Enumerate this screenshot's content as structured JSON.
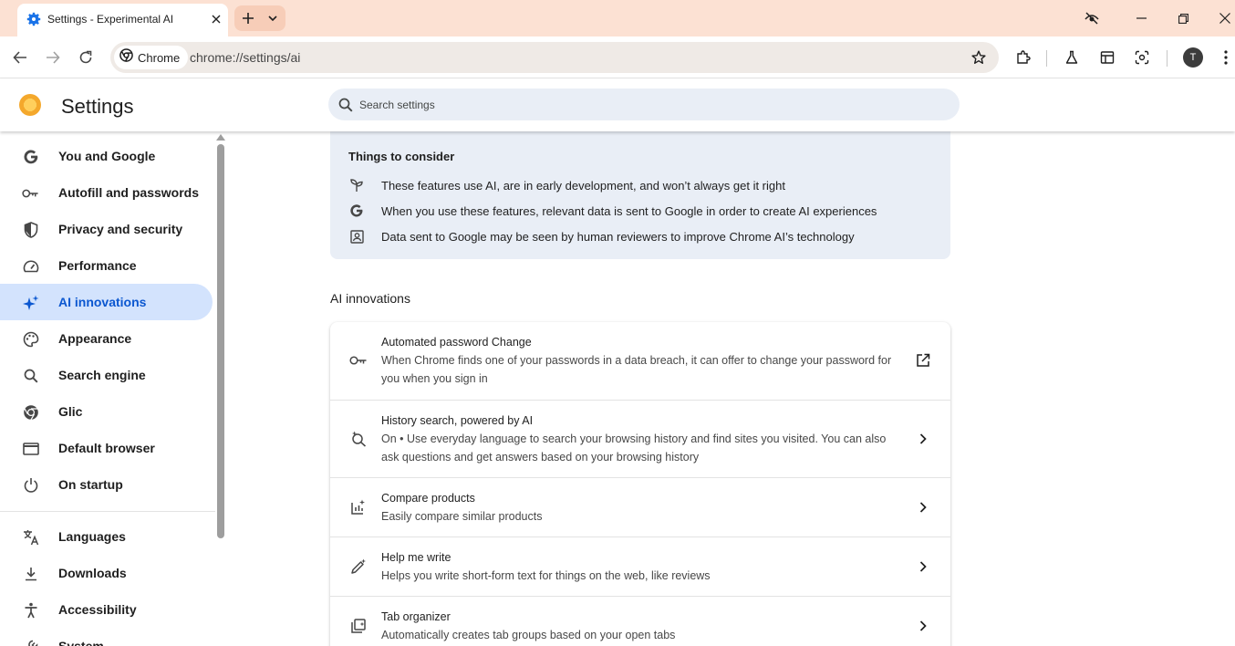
{
  "browser": {
    "tab_title": "Settings - Experimental AI",
    "chip_label": "Chrome",
    "url": "chrome://settings/ai",
    "profile_initial": "T",
    "accent_color": "#0b57d0",
    "frame_color": "#fce1d3"
  },
  "settings": {
    "title": "Settings",
    "search_placeholder": "Search settings"
  },
  "sidebar": {
    "items": [
      {
        "label": "You and Google",
        "icon": "google-g-icon"
      },
      {
        "label": "Autofill and passwords",
        "icon": "key-icon"
      },
      {
        "label": "Privacy and security",
        "icon": "shield-icon"
      },
      {
        "label": "Performance",
        "icon": "speedometer-icon"
      },
      {
        "label": "AI innovations",
        "icon": "sparkle-icon",
        "active": true
      },
      {
        "label": "Appearance",
        "icon": "palette-icon"
      },
      {
        "label": "Search engine",
        "icon": "search-icon"
      },
      {
        "label": "Glic",
        "icon": "chrome-icon"
      },
      {
        "label": "Default browser",
        "icon": "browser-window-icon"
      },
      {
        "label": "On startup",
        "icon": "power-icon"
      },
      {
        "label": "Languages",
        "icon": "translate-icon"
      },
      {
        "label": "Downloads",
        "icon": "download-icon"
      },
      {
        "label": "Accessibility",
        "icon": "accessibility-icon"
      },
      {
        "label": "System",
        "icon": "wrench-icon"
      }
    ]
  },
  "consider": {
    "heading": "Things to consider",
    "items": [
      {
        "text": "These features use AI, are in early development, and won’t always get it right",
        "icon": "sprout-icon"
      },
      {
        "text": "When you use these features, relevant data is sent to Google in order to create AI experiences",
        "icon": "google-g-icon"
      },
      {
        "text": "Data sent to Google may be seen by human reviewers to improve Chrome AI’s technology",
        "icon": "reviewer-icon"
      }
    ]
  },
  "ai_section": {
    "title": "AI innovations",
    "rows": [
      {
        "title": "Automated password Change",
        "desc": "When Chrome finds one of your passwords in a data breach, it can offer to change your password for you when you sign in",
        "icon": "key-icon",
        "action": "open-external-icon"
      },
      {
        "title": "History search, powered by AI",
        "desc": "On • Use everyday language to search your browsing history and find sites you visited. You can also ask questions and get answers based on your browsing history",
        "icon": "search-sparkle-icon",
        "action": "chevron-right-icon"
      },
      {
        "title": "Compare products",
        "desc": "Easily compare similar products",
        "icon": "compare-icon",
        "action": "chevron-right-icon"
      },
      {
        "title": "Help me write",
        "desc": "Helps you write short-form text for things on the web, like reviews",
        "icon": "pen-sparkle-icon",
        "action": "chevron-right-icon"
      },
      {
        "title": "Tab organizer",
        "desc": "Automatically creates tab groups based on your open tabs",
        "icon": "tab-organizer-icon",
        "action": "chevron-right-icon"
      }
    ]
  }
}
